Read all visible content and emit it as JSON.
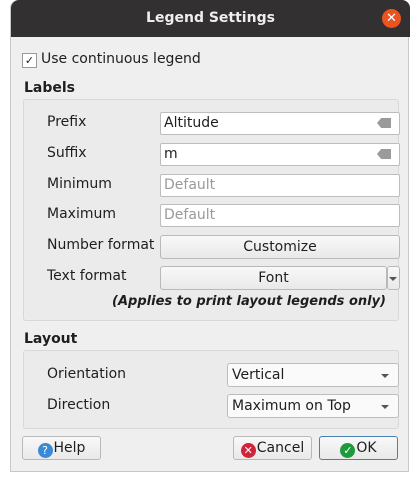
{
  "title": "Legend Settings",
  "use_continuous_legend": {
    "label": "Use continuous legend",
    "checked": true
  },
  "labels": {
    "header": "Labels",
    "prefix_label": "Prefix",
    "prefix_value": "Altitude",
    "suffix_label": "Suffix",
    "suffix_value": "m",
    "minimum_label": "Minimum",
    "minimum_placeholder": "Default",
    "maximum_label": "Maximum",
    "maximum_placeholder": "Default",
    "number_format_label": "Number format",
    "number_format_button": "Customize",
    "text_format_label": "Text format",
    "text_format_button": "Font",
    "note": "(Applies to print layout legends only)"
  },
  "layout": {
    "header": "Layout",
    "orientation_label": "Orientation",
    "orientation_value": "Vertical",
    "direction_label": "Direction",
    "direction_value": "Maximum on Top"
  },
  "buttons": {
    "help": "Help",
    "cancel": "Cancel",
    "ok": "OK"
  }
}
